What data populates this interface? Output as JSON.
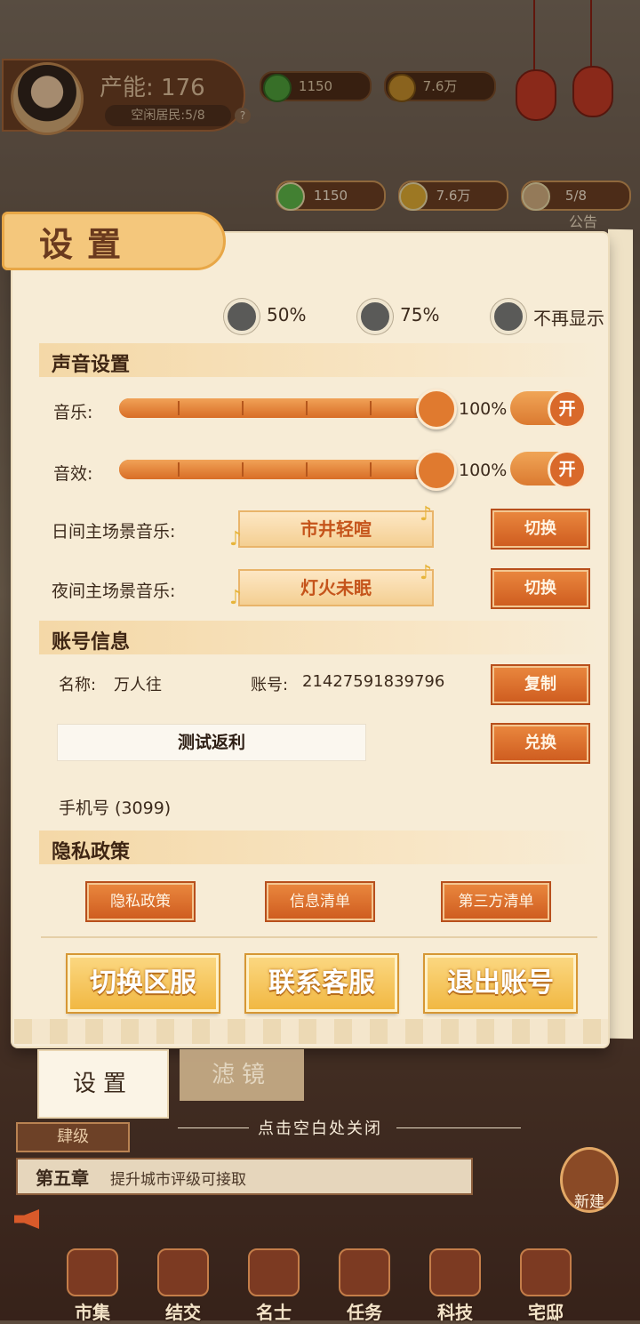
{
  "hud": {
    "capacity": "产能: 176",
    "idle_residents": "空闲居民:5/8",
    "help": "?",
    "top_currency_1": "1150",
    "top_currency_2": "7.6万",
    "res_coin": "1150",
    "res_gold": "7.6万",
    "res_people": "5/8",
    "announcement": "公告"
  },
  "panel": {
    "title": "设置",
    "opacity_options": [
      {
        "label": "50%"
      },
      {
        "label": "75%"
      },
      {
        "label": "不再显示"
      }
    ],
    "sound": {
      "section_title": "声音设置",
      "music_label": "音乐:",
      "music_value": 1.0,
      "music_pct": "100%",
      "music_toggle": "开",
      "sfx_label": "音效:",
      "sfx_value": 1.0,
      "sfx_pct": "100%",
      "sfx_toggle": "开",
      "day_label": "日间主场景音乐:",
      "day_track": "市井轻喧",
      "night_label": "夜间主场景音乐:",
      "night_track": "灯火未眠",
      "switch_label": "切换"
    },
    "account": {
      "section_title": "账号信息",
      "name_label": "名称:",
      "name_value": "万人往",
      "id_label": "账号:",
      "id_value": "21427591839796",
      "copy_label": "复制",
      "code_input": "测试返利",
      "redeem_label": "兑换",
      "phone": "手机号 (3099)"
    },
    "privacy": {
      "section_title": "隐私政策",
      "buttons": [
        "隐私政策",
        "信息清单",
        "第三方清单"
      ]
    },
    "actions": [
      "切换区服",
      "联系客服",
      "退出账号"
    ]
  },
  "tabs": {
    "settings": "设置",
    "filter": "滤镜"
  },
  "hint": "点击空白处关闭",
  "bottom": {
    "level": "肆级",
    "chapter_num": "第五章",
    "chapter_text": "提升城市评级可接取",
    "build": "新建",
    "nav": [
      "市集",
      "结交",
      "名士",
      "任务",
      "科技",
      "宅邸"
    ]
  },
  "colors": {
    "panel_bg": "#f7ecd6",
    "accent_orange": "#d86d26",
    "gold_button": "#f1b843",
    "text_dark": "#3c2a1c"
  }
}
